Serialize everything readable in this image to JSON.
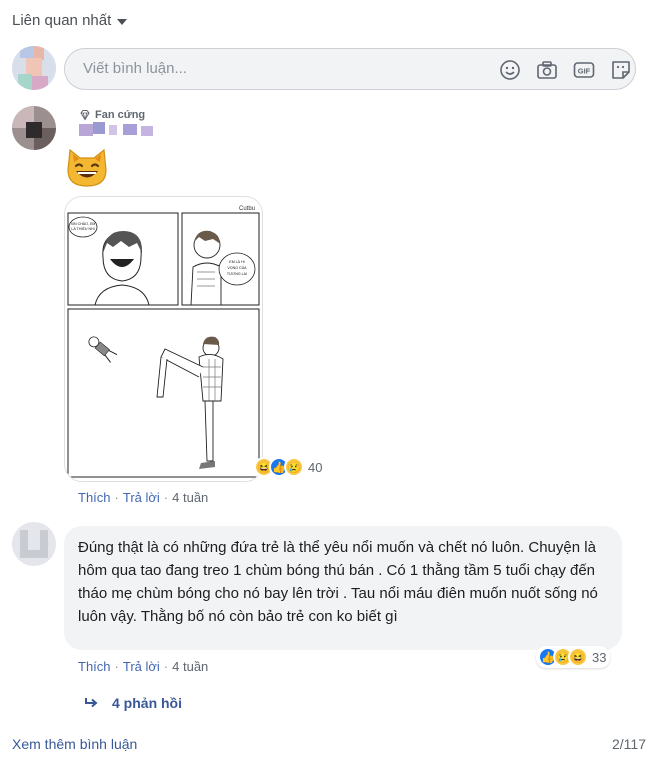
{
  "sort": {
    "label": "Liên quan nhất"
  },
  "composer": {
    "placeholder": "Viết bình luận..."
  },
  "comment1": {
    "badge": "Fan cứng",
    "comic_watermark": "Cutbu",
    "panel1_text": "XIN CHÀO, EM LÀ THIỀU NHI",
    "panel2_text": "EM LÀ HI VỌNG CỦA TƯƠNG LAI",
    "reaction_count": "40",
    "actions": {
      "like": "Thích",
      "reply": "Trả lời",
      "time": "4 tuần"
    }
  },
  "comment2": {
    "text": "Đúng thật là có những đứa trẻ là    thể yêu nổi muốn và chết          nó luôn. Chuyện là hôm qua tao đang treo 1 chùm bóng thú bán . Có 1 thằng tầm 5 tuổi chạy đến tháo mẹ chùm bóng cho nó bay lên trời . Tau nổi máu điên muốn nuốt sống nó luôn vậy. Thằng bố nó còn bảo trẻ con ko biết gì",
    "reaction_count": "33",
    "actions": {
      "like": "Thích",
      "reply": "Trả lời",
      "time": "4 tuần"
    },
    "replies_label": "4 phản hồi"
  },
  "footer": {
    "more_label": "Xem thêm bình luận",
    "count": "2/117"
  },
  "colors": {
    "link": "#385898",
    "bubble": "#f2f3f5",
    "like_blue": "#1877f2",
    "haha_yellow": "#f7c844"
  }
}
